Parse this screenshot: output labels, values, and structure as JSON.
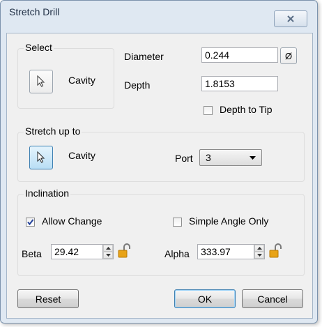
{
  "dialog": {
    "title": "Stretch Drill",
    "close_icon": "close-icon"
  },
  "select_group": {
    "label": "Select",
    "icon": "pointer-icon",
    "target_label": "Cavity"
  },
  "diameter": {
    "label": "Diameter",
    "value": "0.244",
    "button_symbol": "Ø"
  },
  "depth": {
    "label": "Depth",
    "value": "1.8153"
  },
  "depth_to_tip": {
    "label": "Depth to Tip",
    "checked": false
  },
  "stretch_group": {
    "label": "Stretch up to",
    "icon": "pointer-icon",
    "target_label": "Cavity",
    "port_label": "Port",
    "port_value": "3"
  },
  "inclination": {
    "label": "Inclination",
    "allow_change": {
      "label": "Allow Change",
      "checked": true
    },
    "simple_angle_only": {
      "label": "Simple Angle Only",
      "checked": false
    },
    "beta": {
      "label": "Beta",
      "value": "29.42",
      "lock_icon": "unlocked-padlock-icon"
    },
    "alpha": {
      "label": "Alpha",
      "value": "333.97",
      "lock_icon": "unlocked-padlock-icon"
    }
  },
  "buttons": {
    "reset": "Reset",
    "ok": "OK",
    "cancel": "Cancel"
  },
  "colors": {
    "accent": "#3c7fb1",
    "lock": "#e8a317",
    "check": "#21409a"
  }
}
